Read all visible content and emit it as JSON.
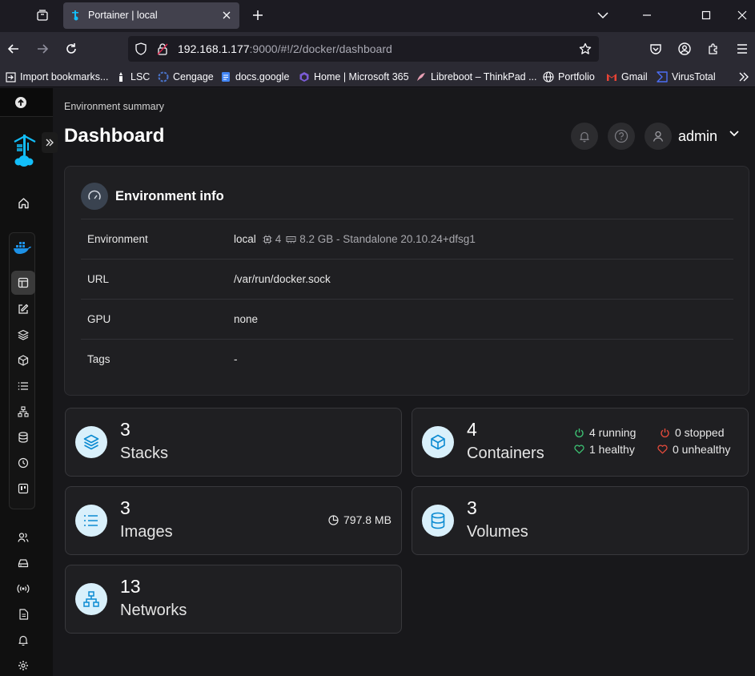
{
  "browser": {
    "tab_title": "Portainer | local",
    "url_host": "192.168.1.177",
    "url_path": ":9000/#!/2/docker/dashboard"
  },
  "bookmarks": [
    {
      "label": "Import bookmarks...",
      "icon": "import-icon"
    },
    {
      "label": "LSC",
      "icon": "lsc-icon"
    },
    {
      "label": "Cengage",
      "icon": "cengage-icon"
    },
    {
      "label": "docs.google",
      "icon": "docs-icon"
    },
    {
      "label": "Home | Microsoft 365",
      "icon": "microsoft365-icon"
    },
    {
      "label": "Libreboot – ThinkPad ...",
      "icon": "libreboot-icon"
    },
    {
      "label": "Portfolio",
      "icon": "globe-icon"
    },
    {
      "label": "Gmail",
      "icon": "gmail-icon"
    },
    {
      "label": "VirusTotal",
      "icon": "virustotal-icon"
    }
  ],
  "header": {
    "breadcrumb": "Environment summary",
    "title": "Dashboard",
    "user": "admin"
  },
  "env_info": {
    "title": "Environment info",
    "rows": [
      {
        "label": "Environment",
        "name": "local",
        "cpu": "4",
        "memory_info": "8.2 GB - Standalone 20.10.24+dfsg1"
      },
      {
        "label": "URL",
        "value": "/var/run/docker.sock"
      },
      {
        "label": "GPU",
        "value": "none"
      },
      {
        "label": "Tags",
        "value": "-"
      }
    ]
  },
  "stats": {
    "stacks": {
      "count": "3",
      "label": "Stacks"
    },
    "containers": {
      "count": "4",
      "label": "Containers",
      "running": "4 running",
      "stopped": "0 stopped",
      "healthy": "1 healthy",
      "unhealthy": "0 unhealthy"
    },
    "images": {
      "count": "3",
      "label": "Images",
      "size": "797.8 MB"
    },
    "volumes": {
      "count": "3",
      "label": "Volumes"
    },
    "networks": {
      "count": "13",
      "label": "Networks"
    }
  },
  "colors": {
    "accent": "#0b8ad1",
    "accent_bg": "#d9f0fb",
    "running": "#3cbf72",
    "stopped": "#e24a3b"
  }
}
